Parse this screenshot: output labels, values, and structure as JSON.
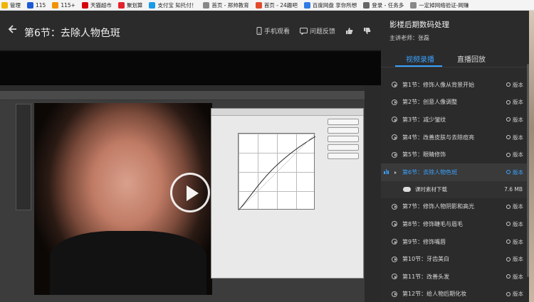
{
  "bookmarks": [
    {
      "label": "管理",
      "icon": "star-icon",
      "color": "#f0b400"
    },
    {
      "label": "115",
      "icon": "s-icon",
      "color": "#1e5ad6"
    },
    {
      "label": "115+",
      "icon": "115-icon",
      "color": "#f39200"
    },
    {
      "label": "天猫超市",
      "icon": "tmall-icon",
      "color": "#d6000f"
    },
    {
      "label": "聚划算",
      "icon": "juhuasuan-icon",
      "color": "#e2232a"
    },
    {
      "label": "支付宝 知托付！",
      "icon": "alipay-icon",
      "color": "#1a9be8"
    },
    {
      "label": "首页 - 邢帅教育",
      "icon": "page-icon",
      "color": "#888888"
    },
    {
      "label": "首页 - 24趣吧",
      "icon": "page-icon",
      "color": "#e24a2c"
    },
    {
      "label": "百度网盘 享你所想",
      "icon": "cloud-icon",
      "color": "#2f7be5"
    },
    {
      "label": "登录 - 任务多",
      "icon": "globe-icon",
      "color": "#666666"
    },
    {
      "label": "一定掉网络验证-网赚",
      "icon": "doc-icon",
      "color": "#888888"
    }
  ],
  "header": {
    "back_icon": "arrow-left-icon",
    "title": "第6节：去除人物色斑",
    "mobile_label": "手机观看",
    "feedback_label": "问题反馈",
    "like_icon": "thumbs-up-icon",
    "dislike_icon": "thumbs-down-icon"
  },
  "sidebar": {
    "course_title": "影楼后期数码处理",
    "teacher": "主讲老师：张磊",
    "tabs": [
      {
        "label": "视频录播",
        "active": true
      },
      {
        "label": "直播回放",
        "active": false
      }
    ],
    "lessons": [
      {
        "label": "第1节：修饰人像从背景开始",
        "version": "版本",
        "active": false
      },
      {
        "label": "第2节：创意人像调整",
        "version": "版本",
        "active": false
      },
      {
        "label": "第3节：减少皱纹",
        "version": "版本",
        "active": false
      },
      {
        "label": "第4节：改善皮肤与去除痘亮",
        "version": "版本",
        "active": false
      },
      {
        "label": "第5节：眼睛修饰",
        "version": "版本",
        "active": false
      },
      {
        "label": "第6节：去除人物色斑",
        "version": "版本",
        "active": true
      }
    ],
    "material": {
      "label": "课时素材下载",
      "size": "7.6 MB"
    },
    "lessons_after": [
      {
        "label": "第7节：修饰人物阴影和高光",
        "version": "版本"
      },
      {
        "label": "第8节：修饰睫毛与眉毛",
        "version": "版本"
      },
      {
        "label": "第9节：修饰嘴唇",
        "version": "版本"
      },
      {
        "label": "第10节：牙齿美白",
        "version": "版本"
      },
      {
        "label": "第11节：改善头发",
        "version": "版本"
      },
      {
        "label": "第12节：给人物后期化妆",
        "version": "版本"
      }
    ],
    "accent": "#3aa2ff"
  }
}
